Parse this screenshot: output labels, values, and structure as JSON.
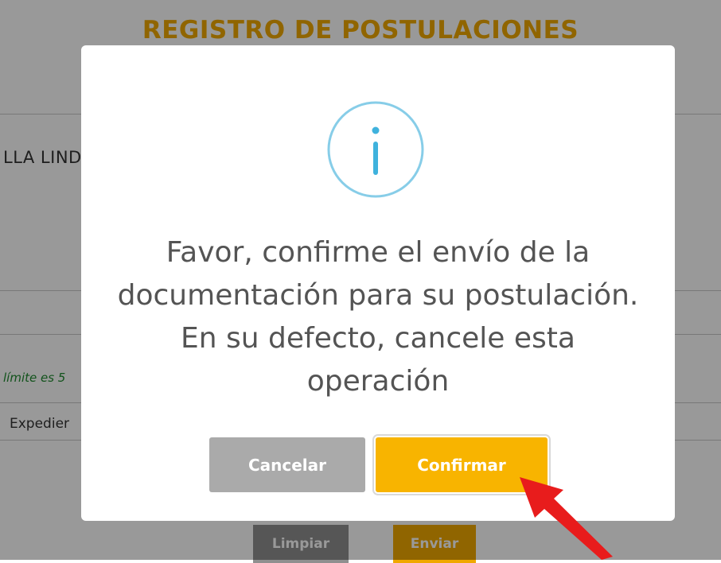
{
  "background_page": {
    "title": "REGISTRO DE POSTULACIONES",
    "name_fragment": "LLA LIND",
    "note_fragment": "límite es 5",
    "field_fragment": "Expedier",
    "clear_button": "Limpiar",
    "send_button": "Enviar"
  },
  "modal": {
    "icon": "info-icon",
    "message": "Favor, confirme el envío de la documentación para su postulación. En su defecto, cancele esta operación",
    "cancel_label": "Cancelar",
    "confirm_label": "Confirmar"
  },
  "colors": {
    "title": "#f0a800",
    "info_icon": "#87cde8",
    "cancel_button": "#aaaaaa",
    "confirm_button": "#f8b400",
    "annotation_arrow": "#e81c1c"
  }
}
